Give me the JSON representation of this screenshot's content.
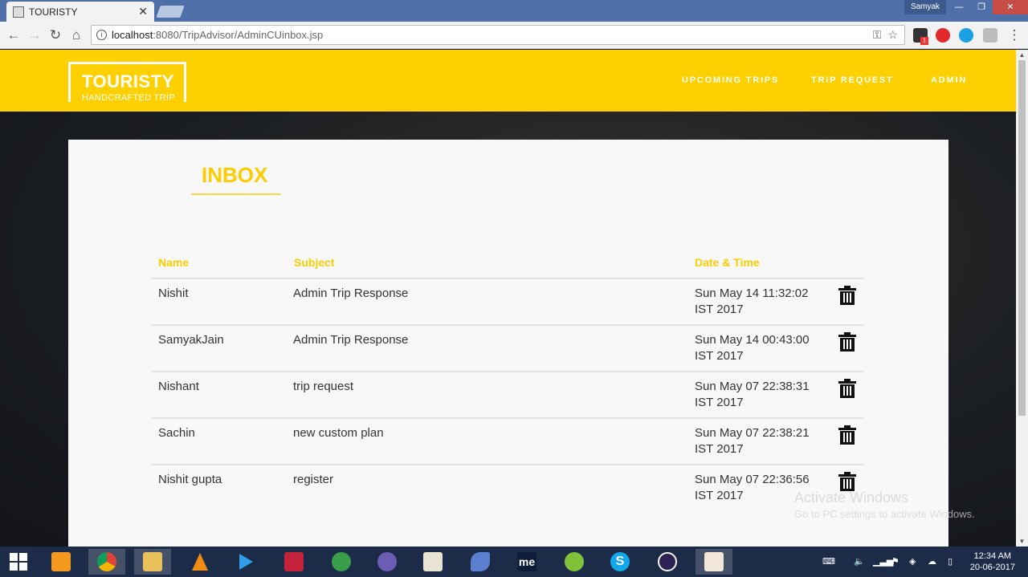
{
  "browser": {
    "tab_title": "TOURISTY",
    "tab_close": "✕",
    "user": "Samyak",
    "url_host": "localhost",
    "url_rest": ":8080/TripAdvisor/AdminCUinbox.jsp",
    "ext_badge": "1"
  },
  "site": {
    "logo_title": "TOURISTY",
    "logo_subtitle": "HANDCRAFTED TRIP",
    "nav": [
      "UPCOMING TRIPS",
      "TRIP REQUEST",
      "ADMIN"
    ]
  },
  "inbox": {
    "title": "INBOX",
    "columns": {
      "name": "Name",
      "subject": "Subject",
      "datetime": "Date & Time"
    },
    "rows": [
      {
        "name": "Nishit",
        "subject": "Admin Trip Response",
        "date1": "Sun May 14 11:32:02",
        "date2": "IST 2017"
      },
      {
        "name": "SamyakJain",
        "subject": "Admin Trip Response",
        "date1": "Sun May 14 00:43:00",
        "date2": "IST 2017"
      },
      {
        "name": "Nishant",
        "subject": "trip request",
        "date1": "Sun May 07 22:38:31",
        "date2": "IST 2017"
      },
      {
        "name": "Sachin",
        "subject": "new custom plan",
        "date1": "Sun May 07 22:38:21",
        "date2": "IST 2017"
      },
      {
        "name": "Nishit gupta",
        "subject": "register",
        "date1": "Sun May 07 22:36:56",
        "date2": "IST 2017"
      }
    ]
  },
  "watermark": {
    "line1": "Activate Windows",
    "line2": "Go to PC settings to activate Windows."
  },
  "taskbar": {
    "time": "12:34 AM",
    "date": "20-06-2017",
    "apps": [
      "start-icon",
      "server-manager-icon",
      "chrome-icon",
      "file-explorer-icon",
      "vlc-icon",
      "media-player-icon",
      "screen-recorder-icon",
      "globe-download-icon",
      "torrent-icon",
      "notepad-icon",
      "dolphin-icon",
      "me-icon",
      "green-app-icon",
      "skype-icon",
      "eclipse-icon",
      "java-icon"
    ]
  },
  "colors": {
    "accent": "#ffd000",
    "heading": "#ffcc00"
  }
}
